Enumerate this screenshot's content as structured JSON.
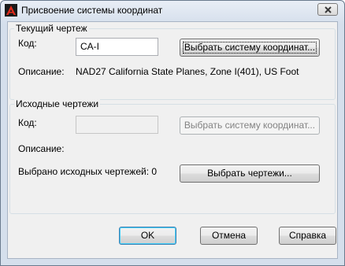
{
  "window": {
    "title": "Присвоение системы координат",
    "close_icon": "close-icon",
    "app_icon": "autocad-logo-icon",
    "accent": "#d42a1e"
  },
  "current_drawing": {
    "group_title": "Текущий чертеж",
    "code_label": "Код:",
    "code_value": "CA-I",
    "select_button": "Выбрать систему координат...",
    "description_label": "Описание:",
    "description_value": "NAD27 California State Planes, Zone I(401), US Foot"
  },
  "source_drawings": {
    "group_title": "Исходные чертежи",
    "code_label": "Код:",
    "code_value": "",
    "select_button": "Выбрать систему координат...",
    "description_label": "Описание:",
    "selected_count_label": "Выбрано исходных чертежей: 0",
    "select_drawings_button": "Выбрать чертежи..."
  },
  "footer": {
    "ok": "OK",
    "cancel": "Отмена",
    "help": "Справка"
  }
}
